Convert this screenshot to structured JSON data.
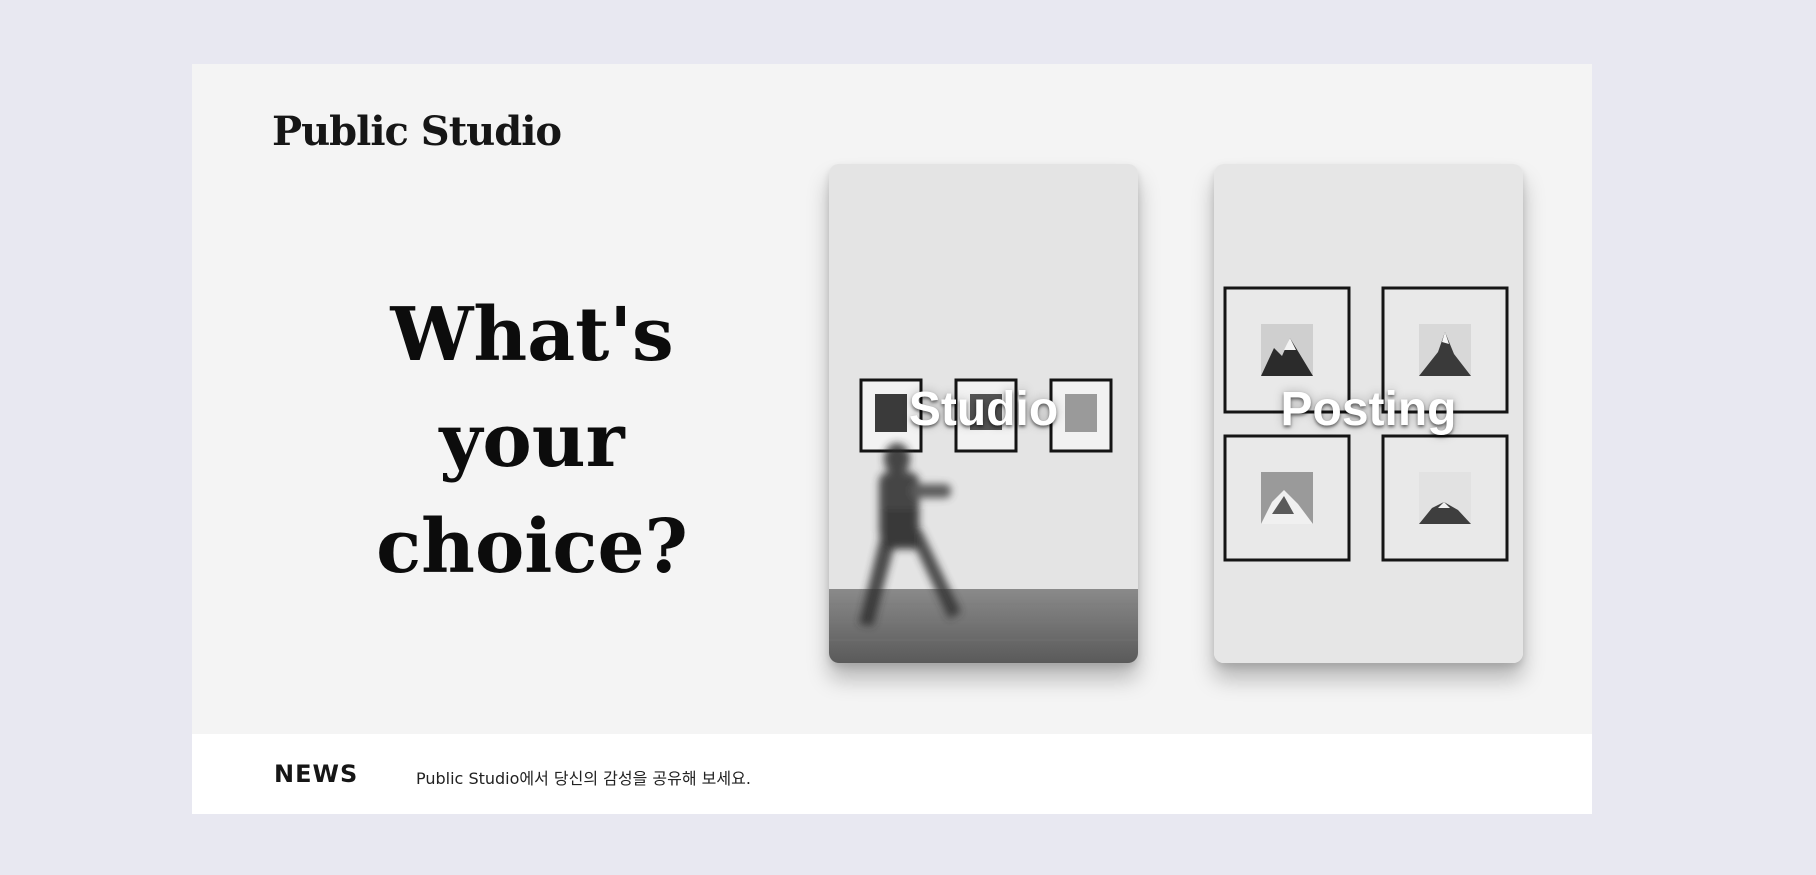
{
  "brand": {
    "logo_text": "Public Studio"
  },
  "hero": {
    "headline_line1": "What's",
    "headline_line2": "your",
    "headline_line3": "choice?"
  },
  "cards": [
    {
      "label": "Studio",
      "image_icon": "gallery-visitor-photo"
    },
    {
      "label": "Posting",
      "image_icon": "framed-mountains-photo"
    }
  ],
  "news": {
    "title": "NEWS",
    "text": "Public Studio에서 당신의 감성을 공유해 보세요."
  },
  "colors": {
    "page_background": "#e8e8f1",
    "frame_background": "#f4f4f4",
    "news_background": "#ffffff",
    "text": "#0c0c0c",
    "card_label": "#ffffff"
  }
}
